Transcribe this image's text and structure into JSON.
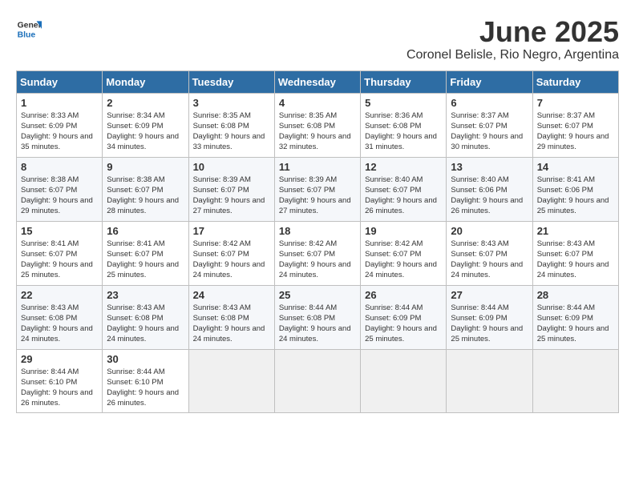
{
  "logo": {
    "general": "General",
    "blue": "Blue"
  },
  "title": "June 2025",
  "subtitle": "Coronel Belisle, Rio Negro, Argentina",
  "days_header": [
    "Sunday",
    "Monday",
    "Tuesday",
    "Wednesday",
    "Thursday",
    "Friday",
    "Saturday"
  ],
  "weeks": [
    [
      {
        "day": "1",
        "sunrise": "8:33 AM",
        "sunset": "6:09 PM",
        "daylight": "9 hours and 35 minutes."
      },
      {
        "day": "2",
        "sunrise": "8:34 AM",
        "sunset": "6:09 PM",
        "daylight": "9 hours and 34 minutes."
      },
      {
        "day": "3",
        "sunrise": "8:35 AM",
        "sunset": "6:08 PM",
        "daylight": "9 hours and 33 minutes."
      },
      {
        "day": "4",
        "sunrise": "8:35 AM",
        "sunset": "6:08 PM",
        "daylight": "9 hours and 32 minutes."
      },
      {
        "day": "5",
        "sunrise": "8:36 AM",
        "sunset": "6:08 PM",
        "daylight": "9 hours and 31 minutes."
      },
      {
        "day": "6",
        "sunrise": "8:37 AM",
        "sunset": "6:07 PM",
        "daylight": "9 hours and 30 minutes."
      },
      {
        "day": "7",
        "sunrise": "8:37 AM",
        "sunset": "6:07 PM",
        "daylight": "9 hours and 29 minutes."
      }
    ],
    [
      {
        "day": "8",
        "sunrise": "8:38 AM",
        "sunset": "6:07 PM",
        "daylight": "9 hours and 29 minutes."
      },
      {
        "day": "9",
        "sunrise": "8:38 AM",
        "sunset": "6:07 PM",
        "daylight": "9 hours and 28 minutes."
      },
      {
        "day": "10",
        "sunrise": "8:39 AM",
        "sunset": "6:07 PM",
        "daylight": "9 hours and 27 minutes."
      },
      {
        "day": "11",
        "sunrise": "8:39 AM",
        "sunset": "6:07 PM",
        "daylight": "9 hours and 27 minutes."
      },
      {
        "day": "12",
        "sunrise": "8:40 AM",
        "sunset": "6:07 PM",
        "daylight": "9 hours and 26 minutes."
      },
      {
        "day": "13",
        "sunrise": "8:40 AM",
        "sunset": "6:06 PM",
        "daylight": "9 hours and 26 minutes."
      },
      {
        "day": "14",
        "sunrise": "8:41 AM",
        "sunset": "6:06 PM",
        "daylight": "9 hours and 25 minutes."
      }
    ],
    [
      {
        "day": "15",
        "sunrise": "8:41 AM",
        "sunset": "6:07 PM",
        "daylight": "9 hours and 25 minutes."
      },
      {
        "day": "16",
        "sunrise": "8:41 AM",
        "sunset": "6:07 PM",
        "daylight": "9 hours and 25 minutes."
      },
      {
        "day": "17",
        "sunrise": "8:42 AM",
        "sunset": "6:07 PM",
        "daylight": "9 hours and 24 minutes."
      },
      {
        "day": "18",
        "sunrise": "8:42 AM",
        "sunset": "6:07 PM",
        "daylight": "9 hours and 24 minutes."
      },
      {
        "day": "19",
        "sunrise": "8:42 AM",
        "sunset": "6:07 PM",
        "daylight": "9 hours and 24 minutes."
      },
      {
        "day": "20",
        "sunrise": "8:43 AM",
        "sunset": "6:07 PM",
        "daylight": "9 hours and 24 minutes."
      },
      {
        "day": "21",
        "sunrise": "8:43 AM",
        "sunset": "6:07 PM",
        "daylight": "9 hours and 24 minutes."
      }
    ],
    [
      {
        "day": "22",
        "sunrise": "8:43 AM",
        "sunset": "6:08 PM",
        "daylight": "9 hours and 24 minutes."
      },
      {
        "day": "23",
        "sunrise": "8:43 AM",
        "sunset": "6:08 PM",
        "daylight": "9 hours and 24 minutes."
      },
      {
        "day": "24",
        "sunrise": "8:43 AM",
        "sunset": "6:08 PM",
        "daylight": "9 hours and 24 minutes."
      },
      {
        "day": "25",
        "sunrise": "8:44 AM",
        "sunset": "6:08 PM",
        "daylight": "9 hours and 24 minutes."
      },
      {
        "day": "26",
        "sunrise": "8:44 AM",
        "sunset": "6:09 PM",
        "daylight": "9 hours and 25 minutes."
      },
      {
        "day": "27",
        "sunrise": "8:44 AM",
        "sunset": "6:09 PM",
        "daylight": "9 hours and 25 minutes."
      },
      {
        "day": "28",
        "sunrise": "8:44 AM",
        "sunset": "6:09 PM",
        "daylight": "9 hours and 25 minutes."
      }
    ],
    [
      {
        "day": "29",
        "sunrise": "8:44 AM",
        "sunset": "6:10 PM",
        "daylight": "9 hours and 26 minutes."
      },
      {
        "day": "30",
        "sunrise": "8:44 AM",
        "sunset": "6:10 PM",
        "daylight": "9 hours and 26 minutes."
      },
      null,
      null,
      null,
      null,
      null
    ]
  ]
}
